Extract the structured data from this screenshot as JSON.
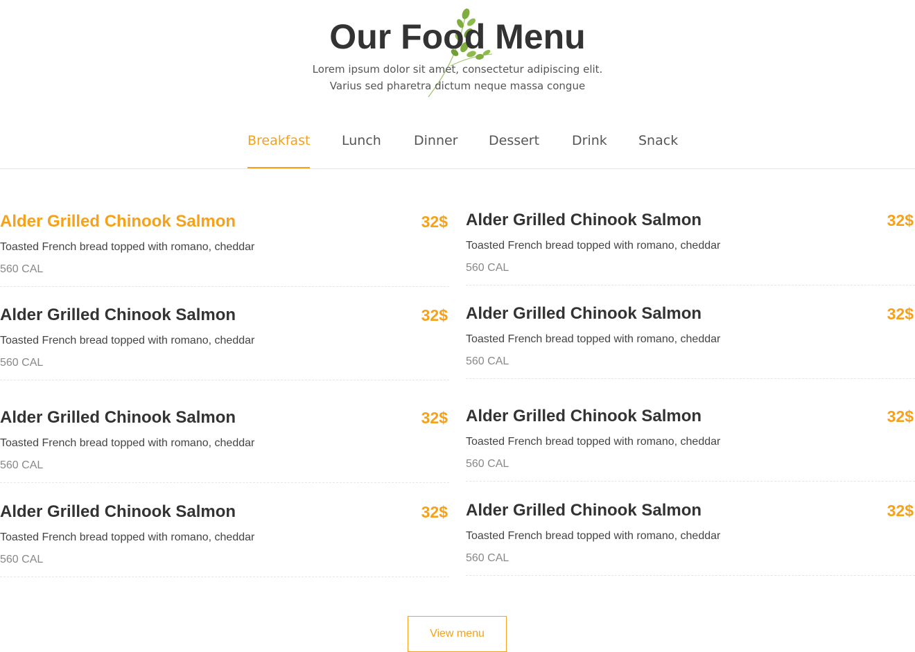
{
  "header": {
    "title": "Our Food Menu",
    "subtitle_line1": "Lorem ipsum dolor sit amet, consectetur adipiscing elit.",
    "subtitle_line2": "Varius sed pharetra dictum neque massa congue"
  },
  "tabs": [
    {
      "label": "Breakfast",
      "active": true
    },
    {
      "label": "Lunch",
      "active": false
    },
    {
      "label": "Dinner",
      "active": false
    },
    {
      "label": "Dessert",
      "active": false
    },
    {
      "label": "Drink",
      "active": false
    },
    {
      "label": "Snack",
      "active": false
    }
  ],
  "menu_items": [
    {
      "name": "Alder Grilled Chinook Salmon",
      "price": "32$",
      "description": "Toasted French bread topped with romano, cheddar",
      "calories": "560 CAL",
      "highlighted": true
    },
    {
      "name": "Alder Grilled Chinook Salmon",
      "price": "32$",
      "description": "Toasted French bread topped with romano, cheddar",
      "calories": "560 CAL",
      "highlighted": false
    },
    {
      "name": "Alder Grilled Chinook Salmon",
      "price": "32$",
      "description": "Toasted French bread topped with romano, cheddar",
      "calories": "560 CAL",
      "highlighted": false
    },
    {
      "name": "Alder Grilled Chinook Salmon",
      "price": "32$",
      "description": "Toasted French bread topped with romano, cheddar",
      "calories": "560 CAL",
      "highlighted": false
    },
    {
      "name": "Alder Grilled Chinook Salmon",
      "price": "32$",
      "description": "Toasted French bread topped with romano, cheddar",
      "calories": "560 CAL",
      "highlighted": false
    },
    {
      "name": "Alder Grilled Chinook Salmon",
      "price": "32$",
      "description": "Toasted French bread topped with romano, cheddar",
      "calories": "560 CAL",
      "highlighted": false
    },
    {
      "name": "Alder Grilled Chinook Salmon",
      "price": "32$",
      "description": "Toasted French bread topped with romano, cheddar",
      "calories": "560 CAL",
      "highlighted": false
    },
    {
      "name": "Alder Grilled Chinook Salmon",
      "price": "32$",
      "description": "Toasted French bread topped with romano, cheddar",
      "calories": "560 CAL",
      "highlighted": false
    }
  ],
  "view_menu_label": "View menu",
  "colors": {
    "accent": "#f5a11c",
    "text_dark": "#333333",
    "text_muted": "#888888",
    "herb_green": "#7fae3f"
  },
  "icons": {
    "herb": "herb-sprig-icon"
  }
}
